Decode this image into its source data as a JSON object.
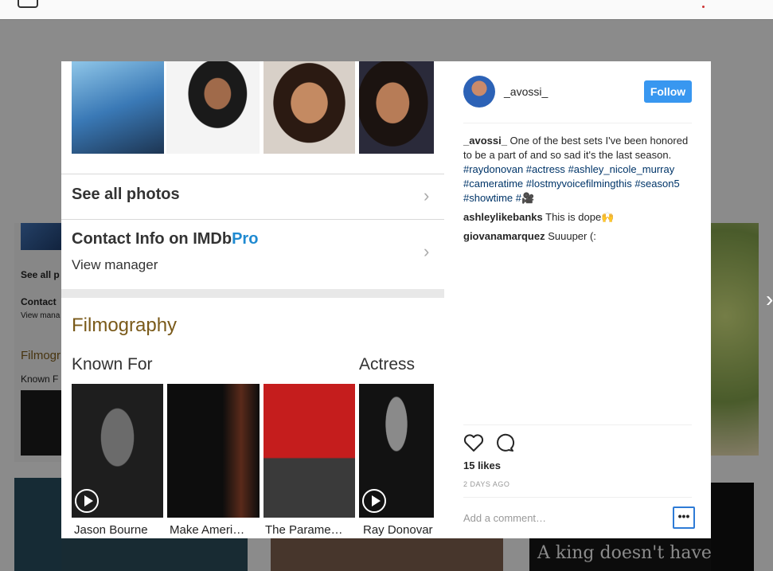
{
  "modal": {
    "photo": {
      "see_all_photos": "See all photos",
      "contact_info_prefix": "Contact Info on ",
      "contact_info_brand": "IMDb",
      "contact_info_brand_pro": "Pro",
      "view_manager": "View manager",
      "filmography": "Filmography",
      "known_for": "Known For",
      "actress": "Actress",
      "posters": [
        {
          "title": "Jason Bourne"
        },
        {
          "title": "Make Ameri…"
        },
        {
          "title": "The Parame…"
        },
        {
          "title": "Ray Donovar"
        }
      ]
    },
    "panel": {
      "username": "_avossi_",
      "follow_label": "Follow",
      "caption": {
        "user": "_avossi_",
        "text": " One of the best sets I've been honored to be a part of and so sad it's the last season. ",
        "hashtags": [
          "#raydonovan",
          "#actress",
          "#ashley_nicole_murray",
          "#cameratime",
          "#lostmyvoicefilmingthis",
          "#season5",
          "#showtime",
          "#🎥"
        ]
      },
      "comments": [
        {
          "user": "ashleylikebanks",
          "text": "This is dope🙌"
        },
        {
          "user": "giovanamarquez",
          "text": "Suuuper (:"
        }
      ],
      "likes": "15 likes",
      "time_ago": "2 DAYS AGO",
      "add_comment_placeholder": "Add a comment…",
      "more_label": "•••"
    }
  },
  "background": {
    "left_labels": [
      "See all p",
      "Contact",
      "View mana",
      "Filmogr",
      "Known F"
    ],
    "bottom_text": "A king doesn't have to"
  },
  "colors": {
    "follow": "#3897f0",
    "hashtag": "#003569",
    "filmography": "#7a5a1a"
  }
}
